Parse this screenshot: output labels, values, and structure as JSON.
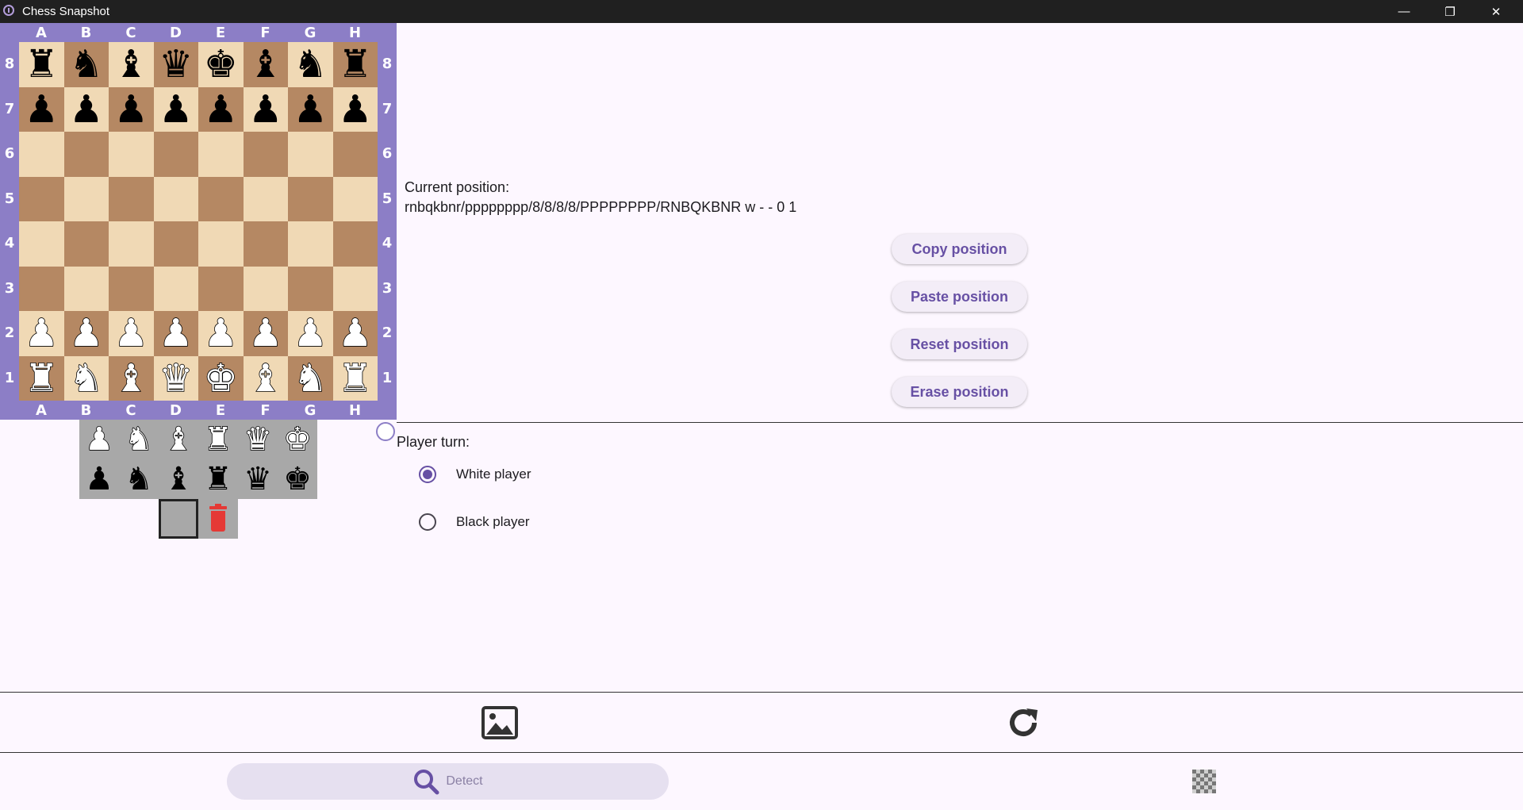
{
  "window": {
    "title": "Chess Snapshot",
    "minimize_glyph": "—",
    "maximize_glyph": "❐",
    "close_glyph": "✕"
  },
  "board": {
    "files": [
      "A",
      "B",
      "C",
      "D",
      "E",
      "F",
      "G",
      "H"
    ],
    "ranks": [
      "8",
      "7",
      "6",
      "5",
      "4",
      "3",
      "2",
      "1"
    ],
    "position": [
      [
        "br",
        "bn",
        "bb",
        "bq",
        "bk",
        "bb",
        "bn",
        "br"
      ],
      [
        "bp",
        "bp",
        "bp",
        "bp",
        "bp",
        "bp",
        "bp",
        "bp"
      ],
      [
        "",
        "",
        "",
        "",
        "",
        "",
        "",
        ""
      ],
      [
        "",
        "",
        "",
        "",
        "",
        "",
        "",
        ""
      ],
      [
        "",
        "",
        "",
        "",
        "",
        "",
        "",
        ""
      ],
      [
        "",
        "",
        "",
        "",
        "",
        "",
        "",
        ""
      ],
      [
        "wp",
        "wp",
        "wp",
        "wp",
        "wp",
        "wp",
        "wp",
        "wp"
      ],
      [
        "wr",
        "wn",
        "wb",
        "wq",
        "wk",
        "wb",
        "wn",
        "wr"
      ]
    ],
    "colors": {
      "light": "#f0d9b5",
      "dark": "#b58863",
      "frame": "#8c7ec6"
    },
    "turn_indicator": "white"
  },
  "palette": {
    "white": [
      "wp",
      "wn",
      "wb",
      "wr",
      "wq",
      "wk"
    ],
    "black": [
      "bp",
      "bn",
      "bb",
      "br",
      "bq",
      "bk"
    ],
    "tools": [
      "empty-square",
      "trash-icon"
    ]
  },
  "position_panel": {
    "label": "Current position:",
    "fen": "rnbqkbnr/pppppppp/8/8/8/8/PPPPPPPP/RNBQKBNR w - - 0 1",
    "buttons": {
      "copy": "Copy position",
      "paste": "Paste position",
      "reset": "Reset position",
      "erase": "Erase position"
    }
  },
  "turn_panel": {
    "label": "Player turn:",
    "options": [
      {
        "label": "White player",
        "selected": true
      },
      {
        "label": "Black player",
        "selected": false
      }
    ]
  },
  "toolbar": {
    "image_icon": "image-icon",
    "redo_icon": "rotate-icon",
    "detect_label": "Detect",
    "detect_icon": "search-icon",
    "board_icon": "checkerboard-icon"
  },
  "accent": "#6750a4"
}
